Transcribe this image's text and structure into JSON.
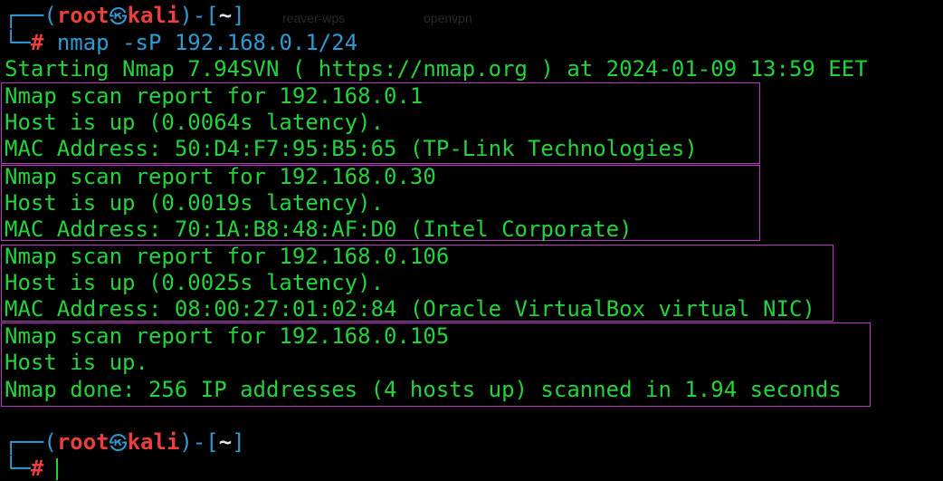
{
  "background_color": "#000000",
  "text_color": "#24d33c",
  "highlight_color": "#c133c7",
  "ghost_labels": [
    "reaver-wps",
    "openvpn"
  ],
  "prompt": {
    "corner_top": "┌──",
    "corner_bottom": "└─",
    "open_paren": "(",
    "user": "root",
    "separator_icon": "㉿",
    "host": "kali",
    "close_paren": ")-[",
    "cwd": "~",
    "close_bracket": "]",
    "hash": "#"
  },
  "command": {
    "tool": "nmap",
    "args": "-sP 192.168.0.1/24"
  },
  "output": {
    "start_line": "Starting Nmap 7.94SVN ( https://nmap.org ) at 2024-01-09 13:59 EET",
    "hosts": [
      {
        "report": "Nmap scan report for 192.168.0.1",
        "status": "Host is up (0.0064s latency).",
        "mac": "MAC Address: 50:D4:F7:95:B5:65 (TP-Link Technologies)"
      },
      {
        "report": "Nmap scan report for 192.168.0.30",
        "status": "Host is up (0.0019s latency).",
        "mac": "MAC Address: 70:1A:B8:48:AF:D0 (Intel Corporate)"
      },
      {
        "report": "Nmap scan report for 192.168.0.106",
        "status": "Host is up (0.0025s latency).",
        "mac": "MAC Address: 08:00:27:01:02:84 (Oracle VirtualBox virtual NIC)"
      },
      {
        "report": "Nmap scan report for 192.168.0.105",
        "status": "Host is up.",
        "mac": ""
      }
    ],
    "done_line": "Nmap done: 256 IP addresses (4 hosts up) scanned in 1.94 seconds"
  }
}
